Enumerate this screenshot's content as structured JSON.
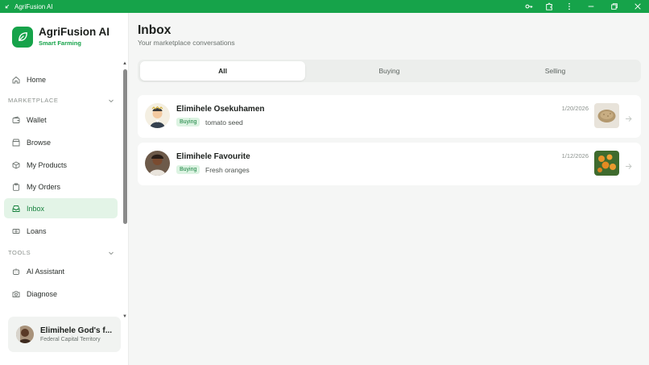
{
  "window": {
    "title": "AgriFusion AI",
    "brand_color": "#16a34a",
    "icons": [
      "back-icon",
      "key-icon",
      "extension-icon",
      "more-vertical-icon",
      "minimize-icon",
      "restore-icon",
      "close-icon"
    ]
  },
  "sidebar": {
    "brand_name": "AgriFusion AI",
    "brand_tagline": "Smart Farming",
    "home": {
      "label": "Home",
      "icon": "home-icon"
    },
    "marketplace": {
      "heading": "MARKETPLACE",
      "items": [
        {
          "label": "Wallet",
          "icon": "wallet-icon"
        },
        {
          "label": "Browse",
          "icon": "store-icon"
        },
        {
          "label": "My Products",
          "icon": "package-icon"
        },
        {
          "label": "My Orders",
          "icon": "clipboard-icon"
        },
        {
          "label": "Inbox",
          "icon": "inbox-icon",
          "active": true
        },
        {
          "label": "Loans",
          "icon": "banknote-icon"
        }
      ]
    },
    "tools": {
      "heading": "TOOLS",
      "items": [
        {
          "label": "AI Assistant",
          "icon": "bot-icon"
        },
        {
          "label": "Diagnose",
          "icon": "camera-icon"
        }
      ]
    },
    "user": {
      "name": "Elimihele God's f...",
      "location": "Federal Capital Territory"
    }
  },
  "main": {
    "title": "Inbox",
    "subtitle": "Your marketplace conversations",
    "tabs": [
      {
        "label": "All",
        "active": true
      },
      {
        "label": "Buying",
        "active": false
      },
      {
        "label": "Selling",
        "active": false
      }
    ],
    "conversations": [
      {
        "name": "Elimihele Osekuhamen",
        "badge": "Buying",
        "product": "tomato seed",
        "date": "1/20/2026"
      },
      {
        "name": "Elimihele Favourite",
        "badge": "Buying",
        "product": "Fresh oranges",
        "date": "1/12/2026"
      }
    ]
  }
}
